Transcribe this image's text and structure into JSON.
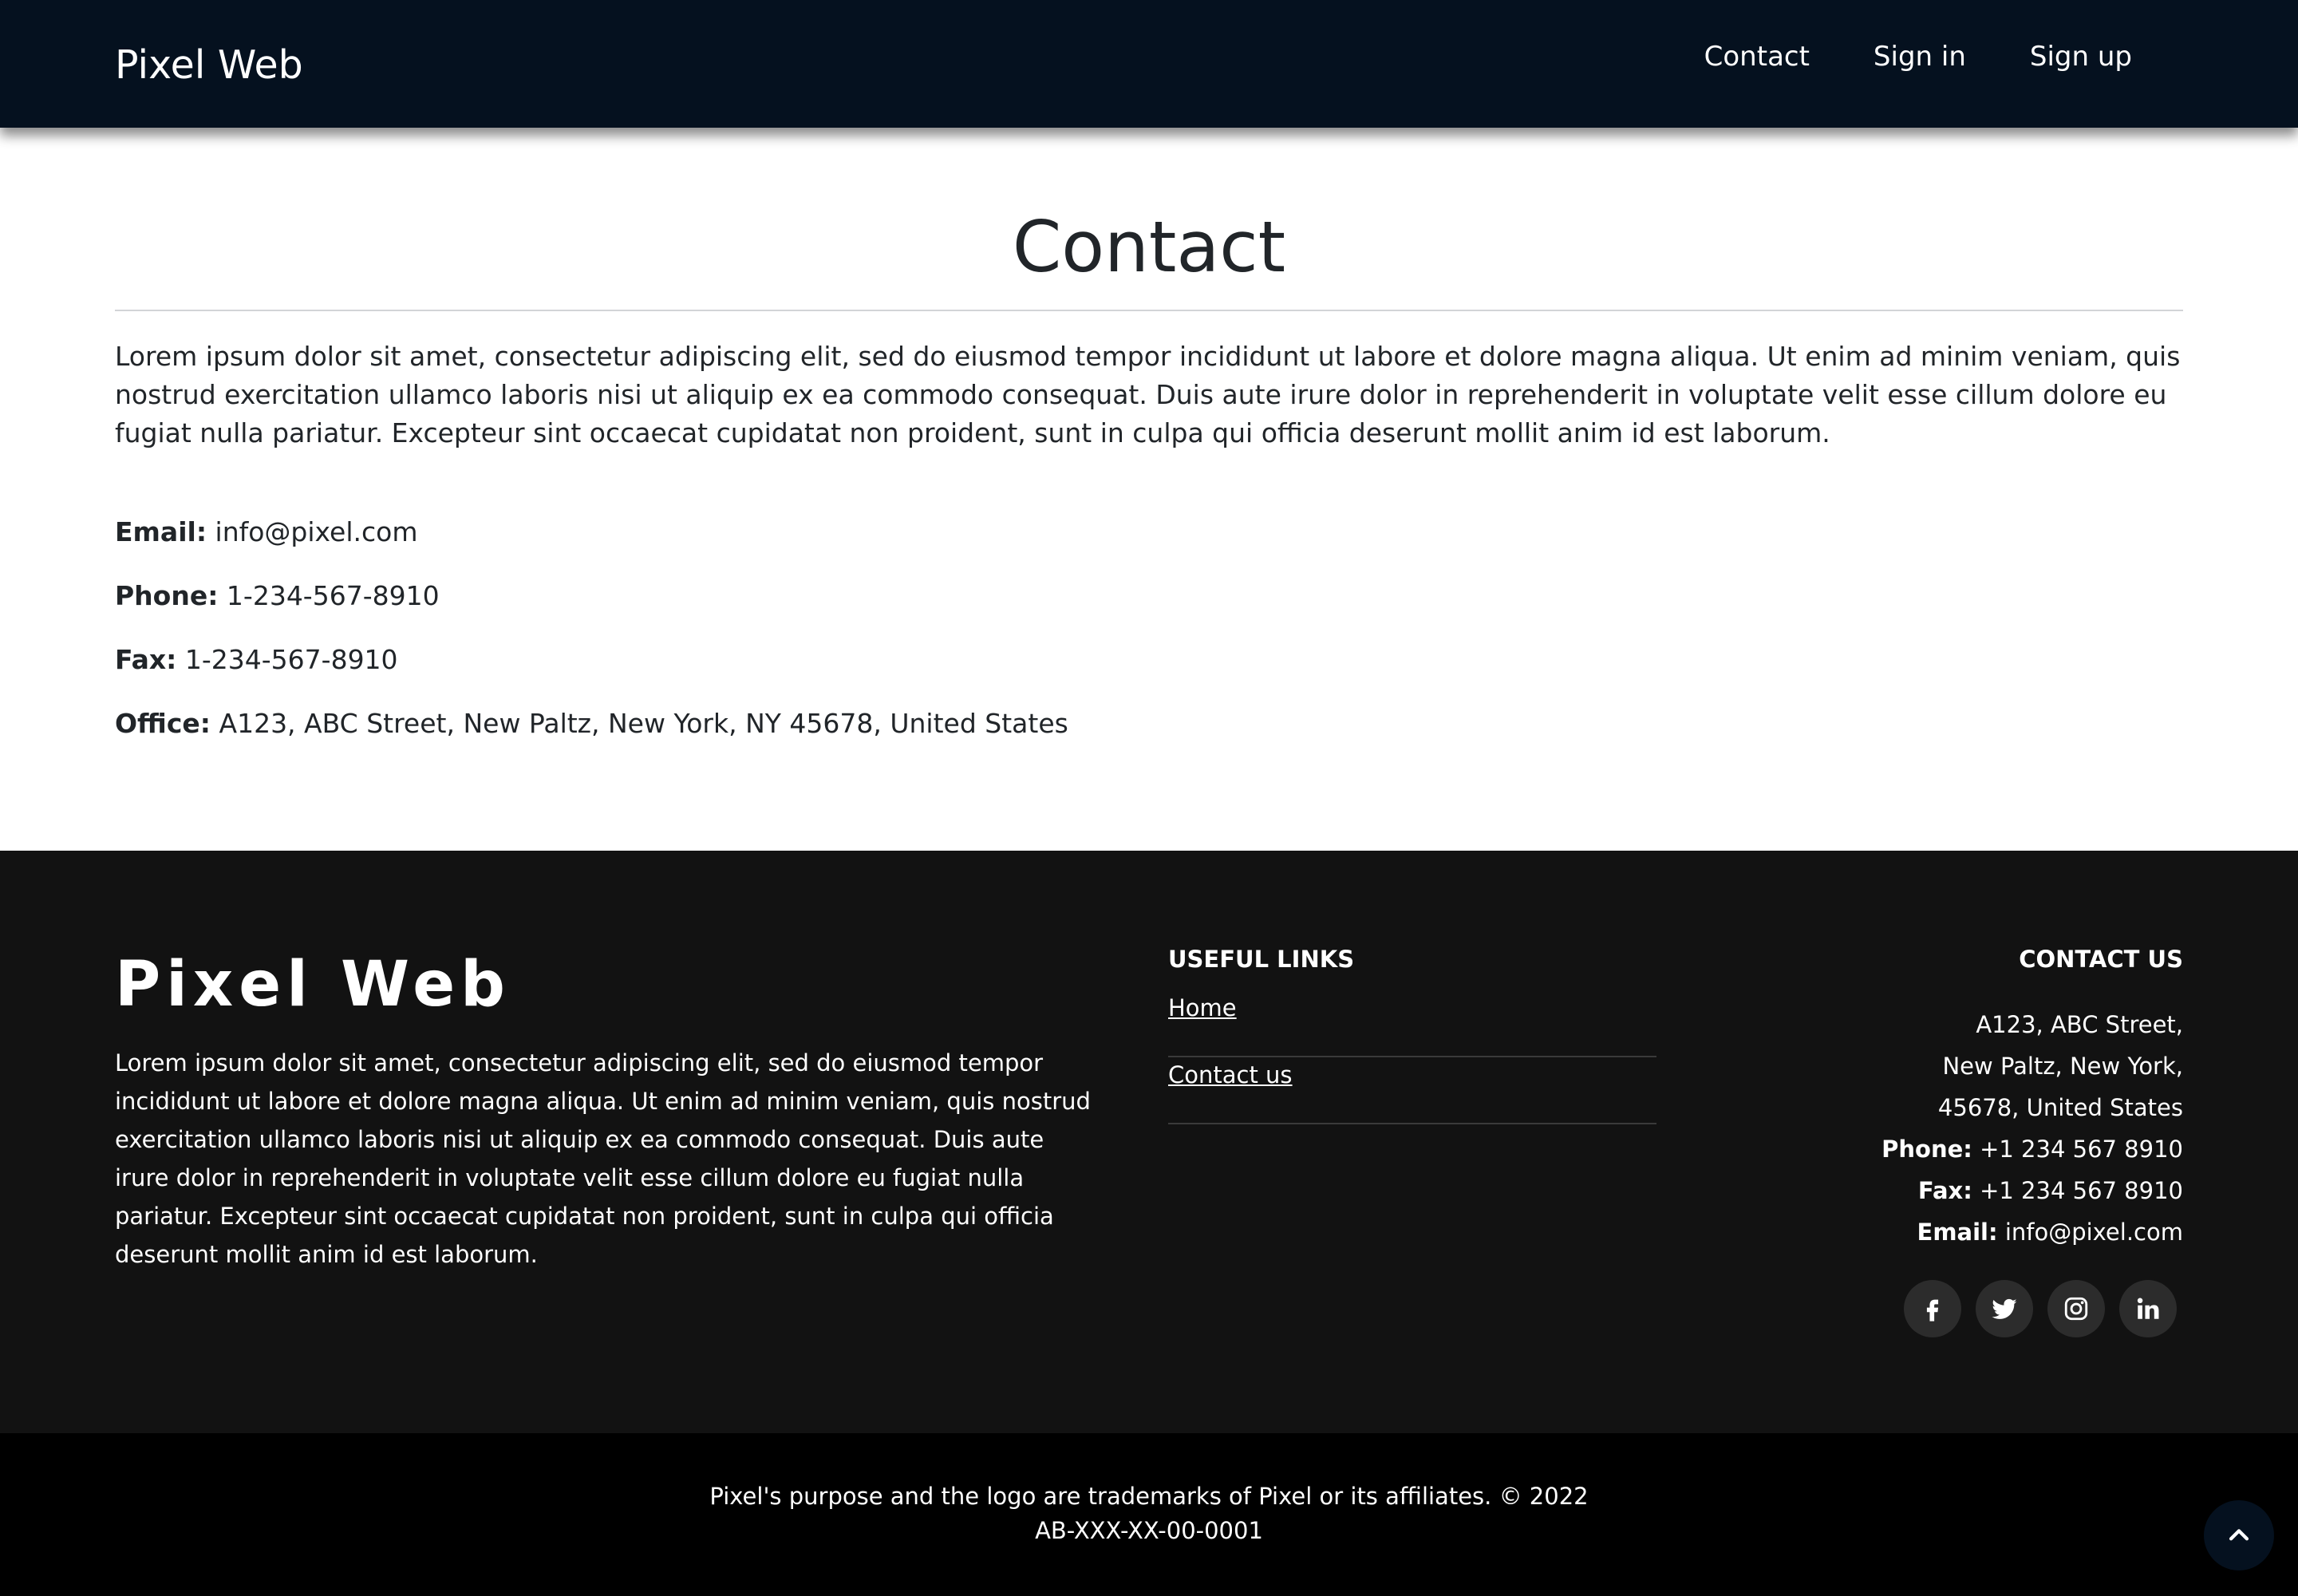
{
  "navbar": {
    "brand": "Pixel Web",
    "links": [
      {
        "label": "Contact"
      },
      {
        "label": "Sign in"
      },
      {
        "label": "Sign up"
      }
    ]
  },
  "main": {
    "title": "Contact",
    "intro": "Lorem ipsum dolor sit amet, consectetur adipiscing elit, sed do eiusmod tempor incididunt ut labore et dolore magna aliqua. Ut enim ad minim veniam, quis nostrud exercitation ullamco laboris nisi ut aliquip ex ea commodo consequat. Duis aute irure dolor in reprehenderit in voluptate velit esse cillum dolore eu fugiat nulla pariatur. Excepteur sint occaecat cupidatat non proident, sunt in culpa qui officia deserunt mollit anim id est laborum.",
    "info": {
      "email_label": "Email:",
      "email_value": "info@pixel.com",
      "phone_label": "Phone:",
      "phone_value": "1-234-567-8910",
      "fax_label": "Fax:",
      "fax_value": "1-234-567-8910",
      "office_label": "Office:",
      "office_value": "A123, ABC Street, New Paltz, New York, NY 45678, United States"
    }
  },
  "footer": {
    "brand": "Pixel Web",
    "about": "Lorem ipsum dolor sit amet, consectetur adipiscing elit, sed do eiusmod tempor incididunt ut labore et dolore magna aliqua. Ut enim ad minim veniam, quis nostrud exercitation ullamco laboris nisi ut aliquip ex ea commodo consequat. Duis aute irure dolor in reprehenderit in voluptate velit esse cillum dolore eu fugiat nulla pariatur. Excepteur sint occaecat cupidatat non proident, sunt in culpa qui officia deserunt mollit anim id est laborum.",
    "useful_links": {
      "heading": "USEFUL LINKS",
      "items": [
        {
          "label": "Home"
        },
        {
          "label": "Contact us"
        }
      ]
    },
    "contact": {
      "heading": "CONTACT US",
      "address_lines": [
        "A123, ABC Street,",
        "New Paltz, New York,",
        "45678, United States"
      ],
      "phone_label": "Phone:",
      "phone_value": "+1 234 567 8910",
      "fax_label": "Fax:",
      "fax_value": "+1 234 567 8910",
      "email_label": "Email:",
      "email_value": "info@pixel.com"
    },
    "socials": [
      {
        "icon": "facebook-icon"
      },
      {
        "icon": "twitter-icon"
      },
      {
        "icon": "instagram-icon"
      },
      {
        "icon": "linkedin-icon"
      }
    ]
  },
  "bottom_bar": {
    "copyright_line1": "Pixel's purpose and the logo are trademarks of Pixel or its affiliates. © 2022",
    "copyright_line2": "AB-XXX-XX-00-0001",
    "back_to_top_icon": "chevron-up-icon"
  },
  "colors": {
    "navbar_bg": "#05111f",
    "footer_bg": "#121212",
    "bottom_bar_bg": "#000000",
    "text_dark": "#212529",
    "social_bg": "#2c2c2c"
  }
}
